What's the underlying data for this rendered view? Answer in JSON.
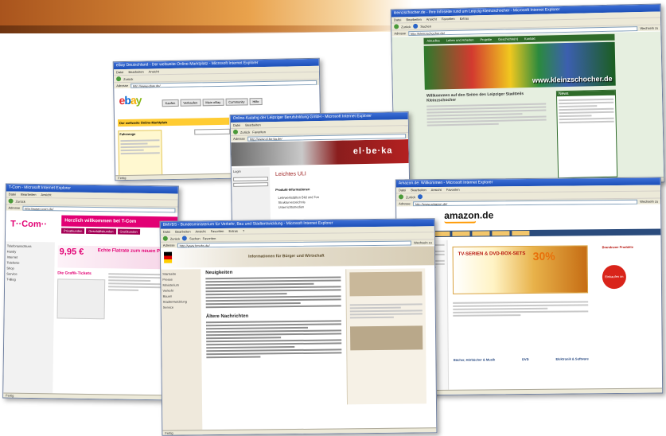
{
  "windows": {
    "kleinzschocher": {
      "title": "kleinzschocher.de - Ihre Infoseite rund um Leipzig-Kleinzschocher - Microsoft Internet Explorer",
      "url": "http://kleinzschocher.de/",
      "site_name": "www.kleinzschocher.de",
      "nav": [
        "Aktuelles",
        "Leben und Arbeiten",
        "Projekte",
        "Geschichte(n)",
        "Kontakt"
      ],
      "welcome": "Willkommen auf den Seiten des Leipziger Stadtteils Kleinzschocher",
      "news_heading": "News"
    },
    "ebay": {
      "title": "eBay Deutschland - Der weltweite Online-Marktplatz - Microsoft Internet Explorer",
      "url": "http://www.ebay.de/",
      "logo": "ebay",
      "tabs": [
        "Kaufen",
        "Verkaufen",
        "Mein eBay",
        "Community",
        "Hilfe"
      ],
      "marketplace": "Der weltweite Online-Marktplatz",
      "search_button": "Finden",
      "sidebar_heading": "Fahrzeuge"
    },
    "elbeka": {
      "title": "Online-Katalog der Leipziger Berufsbildung GmbH - Microsoft Internet Explorer",
      "url": "http://www.el-be-ka.de/",
      "logo": "el·be·ka",
      "login_label": "Login",
      "heading": "Leichtes ULI",
      "section": "Produkt-Informationen",
      "list": [
        "Lehrwerkstätten Bild und Ton",
        "Strukturverzeichnis",
        "Unterrichtsmedien"
      ]
    },
    "tcom": {
      "title": "T-Com - Microsoft Internet Explorer",
      "url": "http://www.t-com.de/",
      "logo": "T··Com··",
      "welcome": "Herzlich willkommen bei T-Com",
      "promo_big": "Echte Flatrate zum neuen Preis",
      "price": "9,95 €",
      "flatrate_heading": "Die Grafik-Tickets",
      "menu": [
        "Privatkunden",
        "Geschäftskunden",
        "Großkunden"
      ],
      "sidebar": [
        "Telefonanschluss",
        "Handy",
        "Internet",
        "Telefonie",
        "Shop",
        "Service",
        "T-Blog"
      ]
    },
    "ministerium": {
      "title": "BMVBS - Bundesministerium für Verkehr, Bau und Stadtentwicklung - Microsoft Internet Explorer",
      "url": "http://www.bmvbs.de/",
      "banner_text": "Informationen für Bürger und Wirtschaft",
      "heading_news": "Neuigkeiten",
      "heading_older": "Ältere Nachrichten",
      "left_nav": [
        "Startseite",
        "Presse",
        "Ministerium",
        "Verkehr",
        "Bauen",
        "Stadtentwicklung",
        "Service"
      ]
    },
    "amazon": {
      "title": "Amazon.de: Willkommen - Microsoft Internet Explorer",
      "url": "http://www.amazon.de/",
      "logo": "amazon.de",
      "promo": "TV-SERIEN & DVD-BOX-SETS",
      "percent": "30%",
      "deals_label": "Einkaufen im Überblick",
      "categories": [
        "Bücher, Hörbücher & Musik",
        "DVD",
        "Elektronik & Software"
      ],
      "col_heading": "Brandneue Produkte"
    }
  },
  "menu_labels": [
    "Datei",
    "Bearbeiten",
    "Ansicht",
    "Favoriten",
    "Extras",
    "?"
  ],
  "toolbar": {
    "back": "Zurück",
    "search": "Suchen",
    "favorites": "Favoriten"
  },
  "address_label": "Adresse",
  "go_label": "Wechseln zu",
  "status_done": "Fertig"
}
